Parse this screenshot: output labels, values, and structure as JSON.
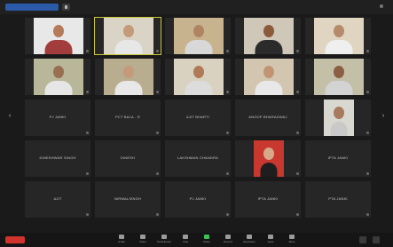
{
  "header": {
    "meeting_title": "",
    "right_text": ""
  },
  "tiles": [
    {
      "name": "",
      "photo": true,
      "bg": "#e8e8e8",
      "skin": "#b57a5a",
      "shirt": "#a33d3d"
    },
    {
      "name": "",
      "photo": true,
      "bg": "#d9d4c6",
      "skin": "#c49a7a",
      "shirt": "#e7e7e7",
      "active": true
    },
    {
      "name": "",
      "photo": true,
      "bg": "#c7b48e",
      "skin": "#b08463",
      "shirt": "#d8d8d8"
    },
    {
      "name": "",
      "photo": true,
      "bg": "#cfc7b8",
      "skin": "#8a5a3b",
      "shirt": "#2b2b2b"
    },
    {
      "name": "",
      "photo": true,
      "bg": "#e0d5c0",
      "skin": "#b58a6b",
      "shirt": "#efefef"
    },
    {
      "name": "",
      "photo": true,
      "bg": "#b8b79a",
      "skin": "#9a6e52",
      "shirt": "#e6e6e6"
    },
    {
      "name": "",
      "photo": true,
      "bg": "#b9ad8f",
      "skin": "#c49a7a",
      "shirt": "#e8e8e8"
    },
    {
      "name": "",
      "photo": true,
      "bg": "#d9d2c0",
      "skin": "#b07a58",
      "shirt": "#dcdcdc"
    },
    {
      "name": "",
      "photo": true,
      "bg": "#d2c6b0",
      "skin": "#c29474",
      "shirt": "#e8e8e8"
    },
    {
      "name": "",
      "photo": true,
      "bg": "#c4bfa7",
      "skin": "#8c5f44",
      "shirt": "#d3d3d3"
    },
    {
      "name": "PJ JANKI"
    },
    {
      "name": "PCT BALA - R"
    },
    {
      "name": "AJIT BHARTI"
    },
    {
      "name": "ANOOP BHARADWAJ"
    },
    {
      "name": "",
      "photo": true,
      "bg": "#d8d8d0",
      "skin": "#a87a5e",
      "shirt": "#c9c9c9",
      "narrow": true
    },
    {
      "name": "DINESHWAR SINGH"
    },
    {
      "name": "DINESH"
    },
    {
      "name": "LAKSHMAN CHANDRA"
    },
    {
      "name": "",
      "photo": true,
      "bg": "#c9382f",
      "skin": "#d7a98b",
      "shirt": "#1e1e1e",
      "narrow": true
    },
    {
      "name": "IPTA JANKI"
    },
    {
      "name": "AJIT"
    },
    {
      "name": "NIRMALSINGH"
    },
    {
      "name": "PJ JANKI"
    },
    {
      "name": "IPTA JANKI"
    },
    {
      "name": "PTA JANKI"
    }
  ],
  "toolbar": {
    "leave_label": "",
    "tools": [
      {
        "label": "Audio",
        "icon": "microphone-icon"
      },
      {
        "label": "Video",
        "icon": "camera-icon"
      },
      {
        "label": "Participants",
        "icon": "participants-icon"
      },
      {
        "label": "Chat",
        "icon": "chat-icon"
      },
      {
        "label": "Share",
        "icon": "share-screen-icon",
        "green": true
      },
      {
        "label": "Record",
        "icon": "record-icon"
      },
      {
        "label": "Reactions",
        "icon": "reactions-icon"
      },
      {
        "label": "Apps",
        "icon": "apps-icon"
      },
      {
        "label": "More",
        "icon": "more-icon"
      }
    ]
  }
}
